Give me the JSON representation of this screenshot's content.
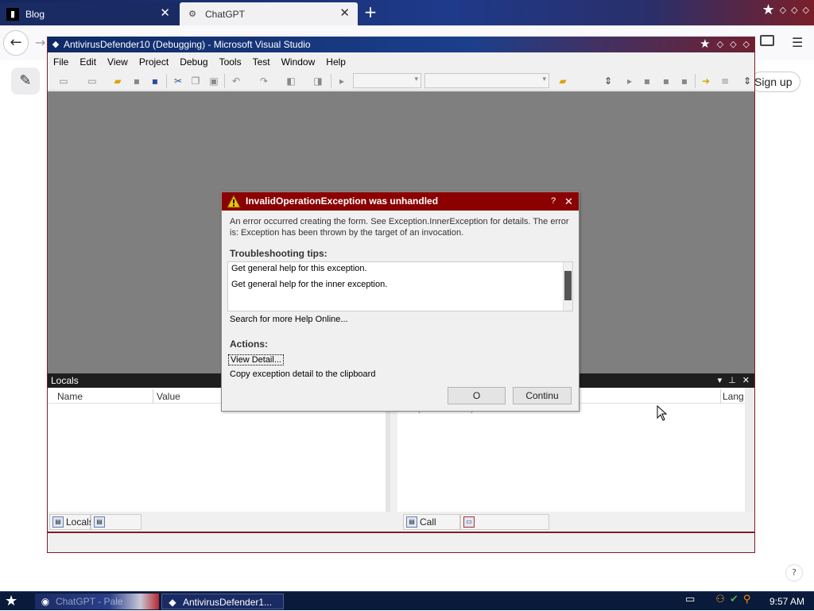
{
  "browser": {
    "tabs": [
      {
        "label": "Blog",
        "icon": "blog-favicon"
      },
      {
        "label": "ChatGPT",
        "icon": "openai-icon"
      }
    ],
    "new_tab_icon": "plus-icon",
    "signup_label": "Sign up",
    "help_label": "?"
  },
  "vs": {
    "title": "AntivirusDefender10 (Debugging) - Microsoft Visual Studio",
    "menu": [
      "File",
      "Edit",
      "View",
      "Project",
      "Debug",
      "Tools",
      "Test",
      "Window",
      "Help"
    ],
    "locals_pane": {
      "title": "Locals",
      "columns": [
        "Name",
        "Value"
      ]
    },
    "callstack_pane": {
      "column_lang": "Lang",
      "row_text": "[External Code]"
    },
    "bottom_tabs": {
      "locals": "Locals",
      "callstack": "Call Stack"
    }
  },
  "dialog": {
    "title": "InvalidOperationException was unhandled",
    "help_label": "?",
    "close_label": "✕",
    "message": "An error occurred creating the form. See Exception.InnerException for details.  The error is: Exception has been thrown by the target of an invocation.",
    "tips_heading": "Troubleshooting tips:",
    "tips": [
      "Get general help for this exception.",
      "Get general help for the inner exception."
    ],
    "help_online": "Search for more Help Online...",
    "actions_heading": "Actions:",
    "actions": [
      "View Detail...",
      "Copy exception detail to the clipboard"
    ],
    "ok_label": "O",
    "continue_label": "Continu"
  },
  "taskbar": {
    "items": [
      {
        "label": "ChatGPT - Pale",
        "icon": "firefox-icon"
      },
      {
        "label": "AntivirusDefender1...",
        "icon": "visual-studio-icon"
      }
    ],
    "clock": "9:57 AM"
  },
  "colors": {
    "dialog_title_bg": "#8b0000",
    "workspace_bg": "#7f7f7f",
    "taskbar_bg": "#0a1a3a"
  }
}
